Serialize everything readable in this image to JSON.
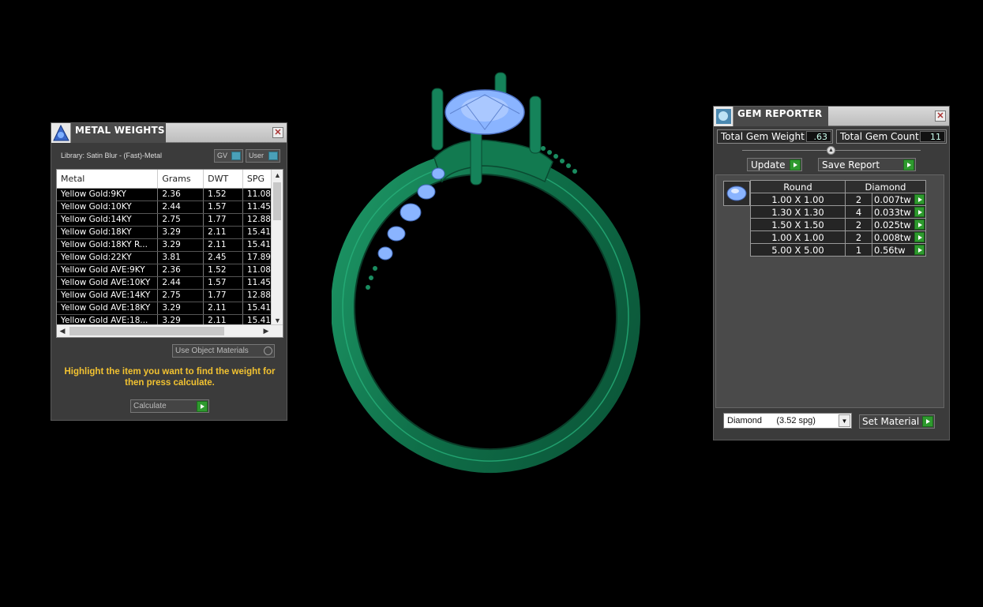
{
  "metal_weights": {
    "title": "METAL WEIGHTS",
    "close": "✕",
    "library": "Library: Satin Blur - (Fast)-Metal",
    "toggle_gv": "GV",
    "toggle_user": "User",
    "columns": [
      "Metal",
      "Grams",
      "DWT",
      "SPG"
    ],
    "rows": [
      [
        "Yellow Gold:9KY",
        "2.36",
        "1.52",
        "11.08"
      ],
      [
        "Yellow Gold:10KY",
        "2.44",
        "1.57",
        "11.45"
      ],
      [
        "Yellow Gold:14KY",
        "2.75",
        "1.77",
        "12.88"
      ],
      [
        "Yellow Gold:18KY",
        "3.29",
        "2.11",
        "15.41"
      ],
      [
        "Yellow Gold:18KY R...",
        "3.29",
        "2.11",
        "15.41"
      ],
      [
        "Yellow Gold:22KY",
        "3.81",
        "2.45",
        "17.89"
      ],
      [
        "Yellow Gold AVE:9KY",
        "2.36",
        "1.52",
        "11.08"
      ],
      [
        "Yellow Gold AVE:10KY",
        "2.44",
        "1.57",
        "11.45"
      ],
      [
        "Yellow Gold AVE:14KY",
        "2.75",
        "1.77",
        "12.88"
      ],
      [
        "Yellow Gold AVE:18KY",
        "3.29",
        "2.11",
        "15.41"
      ],
      [
        "Yellow Gold AVE:18...",
        "3.29",
        "2.11",
        "15.41"
      ]
    ],
    "use_object_materials": "Use Object Materials",
    "hint": "Highlight the item you want to find the weight for then press calculate.",
    "calculate": "Calculate"
  },
  "gem_reporter": {
    "title": "GEM REPORTER",
    "close": "✕",
    "total_weight_label": "Total Gem Weight",
    "total_weight_value": ".63",
    "total_count_label": "Total Gem Count",
    "total_count_value": "11",
    "update": "Update",
    "save_report": "Save Report",
    "columns": [
      "Round",
      "Diamond"
    ],
    "rows": [
      [
        "1.00 X 1.00",
        "2",
        "0.007tw"
      ],
      [
        "1.30 X 1.30",
        "4",
        "0.033tw"
      ],
      [
        "1.50 X 1.50",
        "2",
        "0.025tw"
      ],
      [
        "1.00 X 1.00",
        "2",
        "0.008tw"
      ],
      [
        "5.00 X 5.00",
        "1",
        "0.56tw"
      ]
    ],
    "material_select": "Diamond      (3.52 spg)",
    "set_material": "Set Material"
  },
  "colors": {
    "metal": "#137a52",
    "gem": "#8ab4ff",
    "hint": "#f2c231",
    "button_green": "#2e9a2e"
  }
}
